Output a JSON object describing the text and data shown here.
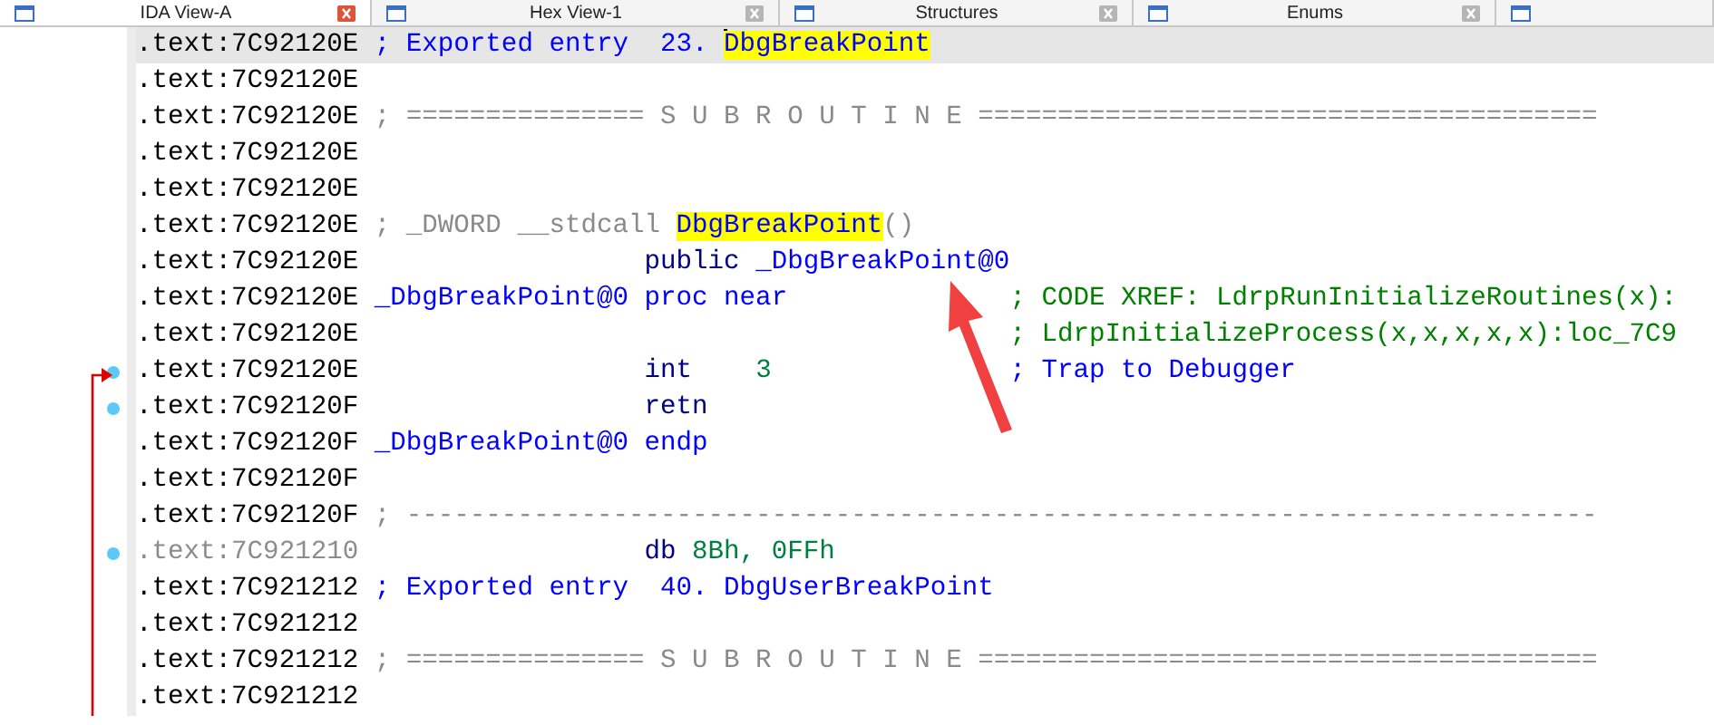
{
  "tabs": [
    {
      "label": "IDA View-A",
      "selected": true
    },
    {
      "label": "Hex View-1",
      "selected": false
    },
    {
      "label": "Structures",
      "selected": false
    },
    {
      "label": "Enums",
      "selected": false
    }
  ],
  "lines": [
    {
      "address": ".text:7C92120E",
      "current": true,
      "marker": false,
      "dimmed": false,
      "text": [
        {
          "kind": "comment",
          "text": "; Exported entry  23. "
        },
        {
          "kind": "highlight",
          "text": "DbgBreakPoint"
        }
      ]
    },
    {
      "address": ".text:7C92120E",
      "current": false,
      "marker": false,
      "dimmed": false
    },
    {
      "address": ".text:7C92120E",
      "current": false,
      "marker": false,
      "dimmed": false,
      "text": [
        {
          "kind": "gray",
          "text": "; =============== S U B R O U T I N E ======================================="
        }
      ]
    },
    {
      "address": ".text:7C92120E",
      "current": false,
      "marker": false,
      "dimmed": false
    },
    {
      "address": ".text:7C92120E",
      "current": false,
      "marker": false,
      "dimmed": false
    },
    {
      "address": ".text:7C92120E",
      "current": false,
      "marker": false,
      "dimmed": false,
      "text": [
        {
          "kind": "gray",
          "text": "; _DWORD __stdcall "
        },
        {
          "kind": "highlight",
          "text": "DbgBreakPoint"
        },
        {
          "kind": "gray",
          "text": "()"
        }
      ]
    },
    {
      "address": ".text:7C92120E",
      "current": false,
      "marker": false,
      "dimmed": false,
      "mnemonic": "public",
      "operands": [
        {
          "kind": "name",
          "text": "_DbgBreakPoint@0"
        }
      ]
    },
    {
      "address": ".text:7C92120E",
      "current": false,
      "marker": false,
      "dimmed": false,
      "text": [
        {
          "kind": "name",
          "text": "_DbgBreakPoint@0 proc near"
        }
      ],
      "comment": [
        {
          "kind": "xref",
          "text": "; CODE XREF: LdrpRunInitializeRoutines(x):"
        }
      ]
    },
    {
      "address": ".text:7C92120E",
      "current": false,
      "marker": false,
      "dimmed": false,
      "comment": [
        {
          "kind": "xref",
          "text": "; LdrpInitializeProcess(x,x,x,x,x):loc_7C9"
        }
      ]
    },
    {
      "address": ".text:7C92120E",
      "current": false,
      "marker": true,
      "dimmed": false,
      "mnemonic": "int",
      "operands": [
        {
          "kind": "number",
          "text": "3"
        }
      ],
      "comment": [
        {
          "kind": "comment",
          "text": "; Trap to Debugger"
        }
      ]
    },
    {
      "address": ".text:7C92120F",
      "current": false,
      "marker": true,
      "dimmed": false,
      "mnemonic": "retn"
    },
    {
      "address": ".text:7C92120F",
      "current": false,
      "marker": false,
      "dimmed": false,
      "text": [
        {
          "kind": "name",
          "text": "_DbgBreakPoint@0 endp"
        }
      ]
    },
    {
      "address": ".text:7C92120F",
      "current": false,
      "marker": false,
      "dimmed": false
    },
    {
      "address": ".text:7C92120F",
      "current": false,
      "marker": false,
      "dimmed": false,
      "text": [
        {
          "kind": "gray",
          "text": "; ---------------------------------------------------------------------------"
        }
      ]
    },
    {
      "address": ".text:7C921210",
      "current": false,
      "marker": true,
      "dimmed": true,
      "kind": "data",
      "mnemonic": "db",
      "operands": [
        {
          "kind": "number",
          "text": "8Bh, 0FFh"
        }
      ]
    },
    {
      "address": ".text:7C921212",
      "current": false,
      "marker": false,
      "dimmed": false,
      "text": [
        {
          "kind": "comment",
          "text": "; Exported entry  40. DbgUserBreakPoint"
        }
      ]
    },
    {
      "address": ".text:7C921212",
      "current": false,
      "marker": false,
      "dimmed": false
    },
    {
      "address": ".text:7C921212",
      "current": false,
      "marker": false,
      "dimmed": false,
      "text": [
        {
          "kind": "gray",
          "text": "; =============== S U B R O U T I N E ======================================="
        }
      ]
    },
    {
      "address": ".text:7C921212",
      "current": false,
      "marker": false,
      "dimmed": false
    }
  ]
}
